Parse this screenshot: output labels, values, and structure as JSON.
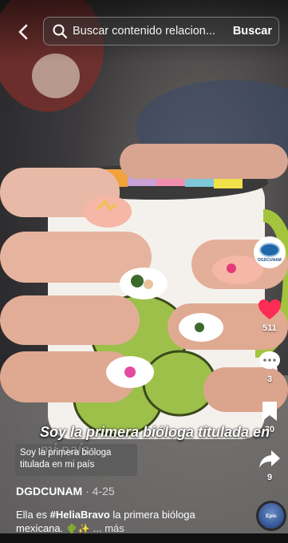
{
  "search": {
    "placeholder": "Buscar contenido relacion...",
    "button_label": "Buscar"
  },
  "actions": {
    "likes": "511",
    "comments": "3",
    "saves": "30",
    "shares": "9"
  },
  "video": {
    "caption": "Soy la primera bióloga titulada en mi país",
    "caption_box": "Soy la primera bióloga titulada en mi país"
  },
  "author": {
    "name": "DGDCUNAM",
    "separator": "·",
    "date": "4-25",
    "avatar_text": "DGDCUNAM"
  },
  "description": {
    "prefix": "Ella es ",
    "hashtag": "#HeliaBravo",
    "suffix": " la primera bióloga mexicana. ",
    "emojis": "🌵✨",
    "more": "... más"
  },
  "music": {
    "label": "Epic"
  },
  "colors": {
    "like_red": "#ff2c55",
    "cactus_green": "#9cc04a",
    "nail_pink": "#f6b7a6"
  },
  "icons": {
    "back": "chevron-left-icon",
    "search": "search-icon",
    "like": "heart-icon",
    "comment": "comment-icon",
    "save": "bookmark-icon",
    "share": "share-icon"
  }
}
